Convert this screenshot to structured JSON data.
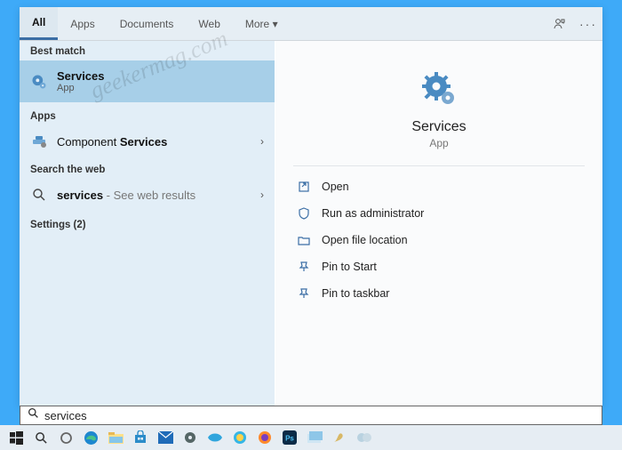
{
  "tabs": {
    "items": [
      {
        "label": "All",
        "active": true
      },
      {
        "label": "Apps",
        "active": false
      },
      {
        "label": "Documents",
        "active": false
      },
      {
        "label": "Web",
        "active": false
      },
      {
        "label": "More",
        "active": false,
        "dropdown": true
      }
    ]
  },
  "left": {
    "best_match_header": "Best match",
    "best_match": {
      "title": "Services",
      "subtitle": "App"
    },
    "apps_header": "Apps",
    "apps": [
      {
        "prefix": "Component ",
        "highlight": "Services"
      }
    ],
    "web_header": "Search the web",
    "web": [
      {
        "query": "services",
        "suffix": " - See web results"
      }
    ],
    "settings_header": "Settings (2)"
  },
  "right": {
    "title": "Services",
    "subtitle": "App",
    "actions": [
      {
        "label": "Open",
        "icon": "open-icon"
      },
      {
        "label": "Run as administrator",
        "icon": "admin-icon"
      },
      {
        "label": "Open file location",
        "icon": "folder-icon"
      },
      {
        "label": "Pin to Start",
        "icon": "pin-start-icon"
      },
      {
        "label": "Pin to taskbar",
        "icon": "pin-taskbar-icon"
      }
    ]
  },
  "search": {
    "value": "services"
  },
  "watermark": "geekermag.com"
}
